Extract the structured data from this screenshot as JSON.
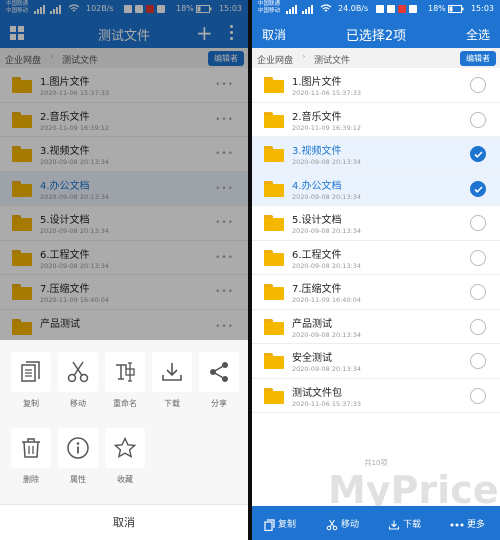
{
  "status": {
    "left": {
      "carrier1": "中国联通",
      "carrier2": "中国移动",
      "net_speed": "102B/s",
      "battery": "18%",
      "time": "15:03"
    },
    "right": {
      "carrier1": "中国联通",
      "carrier2": "中国移动",
      "net_speed": "24.0B/s",
      "battery": "18%",
      "time": "15:03"
    }
  },
  "left": {
    "title": "测试文件",
    "icons": {
      "menu": "grid-icon",
      "add": "plus-icon",
      "more": "more-vert-icon"
    },
    "breadcrumb": [
      "企业网盘",
      "测试文件"
    ],
    "breadcrumb_sep": "›",
    "badge": "编辑者",
    "files": [
      {
        "name": "1.图片文件",
        "date": "2020-11-06 15:37:33"
      },
      {
        "name": "2.音乐文件",
        "date": "2020-11-09 16:39:12"
      },
      {
        "name": "3.视频文件",
        "date": "2020-09-08 20:13:34"
      },
      {
        "name": "4.办公文档",
        "date": "2020-09-08 20:13:34",
        "highlighted": true
      },
      {
        "name": "5.设计文档",
        "date": "2020-09-08 20:13:34"
      },
      {
        "name": "6.工程文件",
        "date": "2020-09-08 20:13:34"
      },
      {
        "name": "7.压缩文件",
        "date": "2020-11-09 16:40:04"
      },
      {
        "name": "产品测试",
        "date": ""
      }
    ],
    "row_more": "•••",
    "actions": [
      {
        "label": "复制",
        "icon": "copy-icon"
      },
      {
        "label": "移动",
        "icon": "scissors-icon"
      },
      {
        "label": "重命名",
        "icon": "rename-icon"
      },
      {
        "label": "下载",
        "icon": "download-icon"
      },
      {
        "label": "分享",
        "icon": "share-icon"
      },
      {
        "label": "删除",
        "icon": "trash-icon"
      },
      {
        "label": "属性",
        "icon": "info-icon"
      },
      {
        "label": "收藏",
        "icon": "star-icon"
      }
    ],
    "cancel": "取消"
  },
  "right": {
    "cancel": "取消",
    "title": "已选择2项",
    "select_all": "全选",
    "breadcrumb": [
      "企业网盘",
      "测试文件"
    ],
    "breadcrumb_sep": "›",
    "badge": "编辑者",
    "files": [
      {
        "name": "1.图片文件",
        "date": "2020-11-06 15:37:33",
        "checked": false
      },
      {
        "name": "2.音乐文件",
        "date": "2020-11-09 16:39:12",
        "checked": false
      },
      {
        "name": "3.视频文件",
        "date": "2020-09-08 20:13:34",
        "checked": true
      },
      {
        "name": "4.办公文档",
        "date": "2020-09-08 20:13:34",
        "checked": true
      },
      {
        "name": "5.设计文档",
        "date": "2020-09-08 20:13:34",
        "checked": false
      },
      {
        "name": "6.工程文件",
        "date": "2020-09-08 20:13:34",
        "checked": false
      },
      {
        "name": "7.压缩文件",
        "date": "2020-11-09 16:40:04",
        "checked": false
      },
      {
        "name": "产品测试",
        "date": "2020-09-08 20:13:34",
        "checked": false
      },
      {
        "name": "安全测试",
        "date": "2020-09-08 20:13:34",
        "checked": false
      },
      {
        "name": "测试文件包",
        "date": "2020-11-06 15:37:33",
        "checked": false
      }
    ],
    "item_count": "共10项",
    "bottom_bar": [
      {
        "label": "复制",
        "icon": "copy-icon"
      },
      {
        "label": "移动",
        "icon": "scissors-icon"
      },
      {
        "label": "下载",
        "icon": "download-icon"
      },
      {
        "label": "更多",
        "icon": "more-horiz-icon"
      }
    ]
  },
  "watermark": "MyPrice",
  "colors": {
    "primary": "#1e74d0",
    "folder": "#f5b800",
    "selected_row": "#eaf3fd"
  }
}
